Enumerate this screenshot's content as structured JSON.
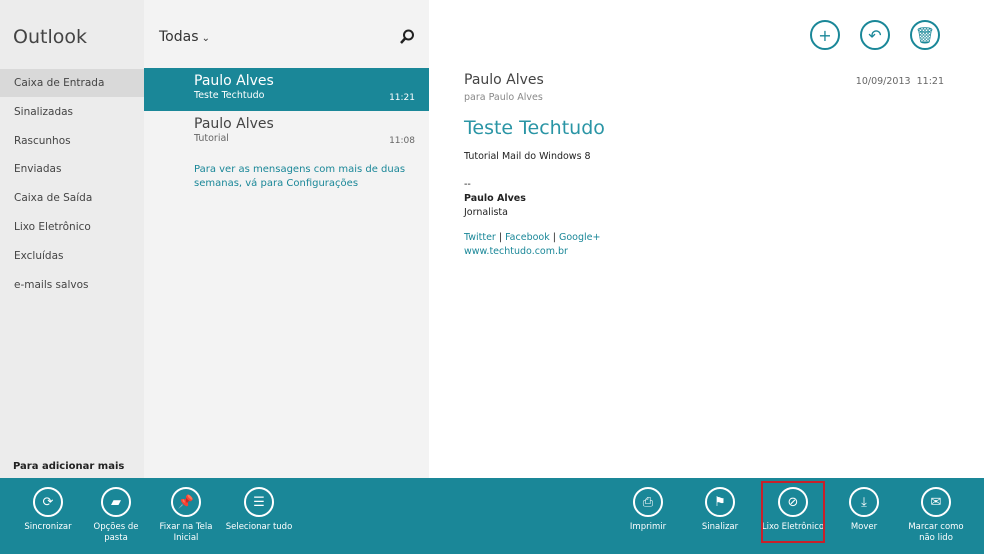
{
  "app": {
    "title": "Outlook",
    "hint": "Para adicionar mais"
  },
  "folders": [
    "Caixa de Entrada",
    "Sinalizadas",
    "Rascunhos",
    "Enviadas",
    "Caixa de Saída",
    "Lixo Eletrônico",
    "Excluídas",
    "e-mails salvos"
  ],
  "list": {
    "filter": "Todas",
    "messages": [
      {
        "from": "Paulo Alves",
        "subject": "Teste Techtudo",
        "time": "11:21"
      },
      {
        "from": "Paulo Alves",
        "subject": "Tutorial",
        "time": "11:08"
      }
    ],
    "note": "Para ver as mensagens com mais de duas semanas, vá para Configurações"
  },
  "reader": {
    "from": "Paulo Alves",
    "to": "para Paulo Alves",
    "date": "10/09/2013",
    "time": "11:21",
    "subject": "Teste Techtudo",
    "body": "Tutorial Mail do Windows 8",
    "sep": "--",
    "sig_name": "Paulo Alves",
    "sig_title": "Jornalista",
    "links": [
      "Twitter",
      "Facebook",
      "Google+"
    ],
    "site": "www.techtudo.com.br"
  },
  "appbar": {
    "left": [
      "Sincronizar",
      "Opções de pasta",
      "Fixar na Tela Inicial",
      "Selecionar tudo"
    ],
    "right": [
      "Imprimir",
      "Sinalizar",
      "Lixo Eletrônico",
      "Mover",
      "Marcar como não lido"
    ]
  },
  "colors": {
    "accent": "#1a8798",
    "highlight": "#c8202a"
  }
}
